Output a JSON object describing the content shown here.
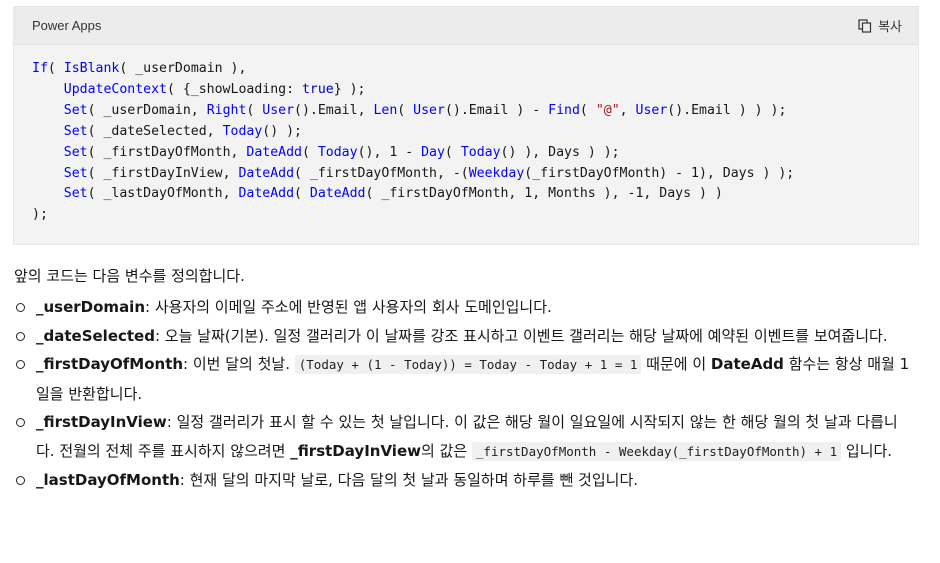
{
  "codeblock": {
    "language": "Power Apps",
    "copy_label": "복사",
    "lines": [
      [
        {
          "t": "If",
          "c": "fn"
        },
        {
          "t": "( ",
          "c": "id"
        },
        {
          "t": "IsBlank",
          "c": "fn"
        },
        {
          "t": "( _userDomain ),",
          "c": "id"
        }
      ],
      [
        {
          "t": "    ",
          "c": "id"
        },
        {
          "t": "UpdateContext",
          "c": "fn"
        },
        {
          "t": "( {_showLoading: ",
          "c": "id"
        },
        {
          "t": "true",
          "c": "kw"
        },
        {
          "t": "} );",
          "c": "id"
        }
      ],
      [
        {
          "t": "    ",
          "c": "id"
        },
        {
          "t": "Set",
          "c": "fn"
        },
        {
          "t": "( _userDomain, ",
          "c": "id"
        },
        {
          "t": "Right",
          "c": "fn"
        },
        {
          "t": "( ",
          "c": "id"
        },
        {
          "t": "User",
          "c": "fn"
        },
        {
          "t": "().Email, ",
          "c": "id"
        },
        {
          "t": "Len",
          "c": "fn"
        },
        {
          "t": "( ",
          "c": "id"
        },
        {
          "t": "User",
          "c": "fn"
        },
        {
          "t": "().Email ) - ",
          "c": "id"
        },
        {
          "t": "Find",
          "c": "fn"
        },
        {
          "t": "( ",
          "c": "id"
        },
        {
          "t": "\"@\"",
          "c": "str"
        },
        {
          "t": ", ",
          "c": "id"
        },
        {
          "t": "User",
          "c": "fn"
        },
        {
          "t": "().Email ) ) );",
          "c": "id"
        }
      ],
      [
        {
          "t": "    ",
          "c": "id"
        },
        {
          "t": "Set",
          "c": "fn"
        },
        {
          "t": "( _dateSelected, ",
          "c": "id"
        },
        {
          "t": "Today",
          "c": "fn"
        },
        {
          "t": "() );",
          "c": "id"
        }
      ],
      [
        {
          "t": "    ",
          "c": "id"
        },
        {
          "t": "Set",
          "c": "fn"
        },
        {
          "t": "( _firstDayOfMonth, ",
          "c": "id"
        },
        {
          "t": "DateAdd",
          "c": "fn"
        },
        {
          "t": "( ",
          "c": "id"
        },
        {
          "t": "Today",
          "c": "fn"
        },
        {
          "t": "(), 1 - ",
          "c": "id"
        },
        {
          "t": "Day",
          "c": "fn"
        },
        {
          "t": "( ",
          "c": "id"
        },
        {
          "t": "Today",
          "c": "fn"
        },
        {
          "t": "() ), Days ) );",
          "c": "id"
        }
      ],
      [
        {
          "t": "    ",
          "c": "id"
        },
        {
          "t": "Set",
          "c": "fn"
        },
        {
          "t": "( _firstDayInView, ",
          "c": "id"
        },
        {
          "t": "DateAdd",
          "c": "fn"
        },
        {
          "t": "( _firstDayOfMonth, -(",
          "c": "id"
        },
        {
          "t": "Weekday",
          "c": "fn"
        },
        {
          "t": "(_firstDayOfMonth) - 1), Days ) );",
          "c": "id"
        }
      ],
      [
        {
          "t": "    ",
          "c": "id"
        },
        {
          "t": "Set",
          "c": "fn"
        },
        {
          "t": "( _lastDayOfMonth, ",
          "c": "id"
        },
        {
          "t": "DateAdd",
          "c": "fn"
        },
        {
          "t": "( ",
          "c": "id"
        },
        {
          "t": "DateAdd",
          "c": "fn"
        },
        {
          "t": "( _firstDayOfMonth, 1, Months ), -1, Days ) )",
          "c": "id"
        }
      ],
      [
        {
          "t": ");",
          "c": "id"
        }
      ]
    ]
  },
  "intro": "앞의 코드는 다음 변수를 정의합니다.",
  "items": [
    {
      "term": "_userDomain",
      "parts": [
        {
          "t": ": 사용자의 이메일 주소에 반영된 앱 사용자의 회사 도메인입니다."
        }
      ]
    },
    {
      "term": "_dateSelected",
      "parts": [
        {
          "t": ": 오늘 날짜(기본). 일정 갤러리가 이 날짜를 강조 표시하고 이벤트 갤러리는 해당 날짜에 예약된 이벤트를 보여줍니다."
        }
      ]
    },
    {
      "term": "_firstDayOfMonth",
      "parts": [
        {
          "t": ": 이번 달의 첫날. "
        },
        {
          "code": "(Today + (1 - Today)) = Today - Today + 1 = 1"
        },
        {
          "t": " 때문에 이 "
        },
        {
          "b": "DateAdd"
        },
        {
          "t": " 함수는 항상 매월 1일을 반환합니다."
        }
      ]
    },
    {
      "term": "_firstDayInView",
      "parts": [
        {
          "t": ": 일정 갤러리가 표시 할 수 있는 첫 날입니다. 이 값은 해당 월이 일요일에 시작되지 않는 한 해당 월의 첫 날과 다릅니다. 전월의 전체 주를 표시하지 않으려면 "
        },
        {
          "b": "_firstDayInView"
        },
        {
          "t": "의 값은 "
        },
        {
          "code": "_firstDayOfMonth - Weekday(_firstDayOfMonth) + 1"
        },
        {
          "t": " 입니다."
        }
      ]
    },
    {
      "term": "_lastDayOfMonth",
      "parts": [
        {
          "t": ": 현재 달의 마지막 날로, 다음 달의 첫 날과 동일하며 하루를 뺀 것입니다."
        }
      ]
    }
  ]
}
